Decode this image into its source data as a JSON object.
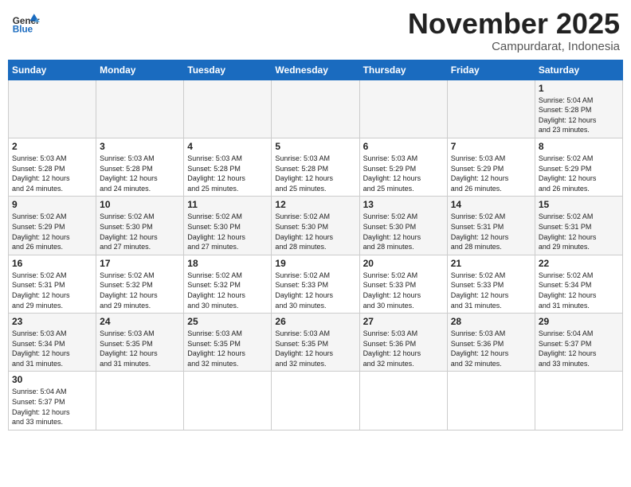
{
  "header": {
    "logo_general": "General",
    "logo_blue": "Blue",
    "month": "November 2025",
    "location": "Campurdarat, Indonesia"
  },
  "weekdays": [
    "Sunday",
    "Monday",
    "Tuesday",
    "Wednesday",
    "Thursday",
    "Friday",
    "Saturday"
  ],
  "weeks": [
    [
      {
        "day": "",
        "info": ""
      },
      {
        "day": "",
        "info": ""
      },
      {
        "day": "",
        "info": ""
      },
      {
        "day": "",
        "info": ""
      },
      {
        "day": "",
        "info": ""
      },
      {
        "day": "",
        "info": ""
      },
      {
        "day": "1",
        "info": "Sunrise: 5:04 AM\nSunset: 5:28 PM\nDaylight: 12 hours\nand 23 minutes."
      }
    ],
    [
      {
        "day": "2",
        "info": "Sunrise: 5:03 AM\nSunset: 5:28 PM\nDaylight: 12 hours\nand 24 minutes."
      },
      {
        "day": "3",
        "info": "Sunrise: 5:03 AM\nSunset: 5:28 PM\nDaylight: 12 hours\nand 24 minutes."
      },
      {
        "day": "4",
        "info": "Sunrise: 5:03 AM\nSunset: 5:28 PM\nDaylight: 12 hours\nand 25 minutes."
      },
      {
        "day": "5",
        "info": "Sunrise: 5:03 AM\nSunset: 5:28 PM\nDaylight: 12 hours\nand 25 minutes."
      },
      {
        "day": "6",
        "info": "Sunrise: 5:03 AM\nSunset: 5:29 PM\nDaylight: 12 hours\nand 25 minutes."
      },
      {
        "day": "7",
        "info": "Sunrise: 5:03 AM\nSunset: 5:29 PM\nDaylight: 12 hours\nand 26 minutes."
      },
      {
        "day": "8",
        "info": "Sunrise: 5:02 AM\nSunset: 5:29 PM\nDaylight: 12 hours\nand 26 minutes."
      }
    ],
    [
      {
        "day": "9",
        "info": "Sunrise: 5:02 AM\nSunset: 5:29 PM\nDaylight: 12 hours\nand 26 minutes."
      },
      {
        "day": "10",
        "info": "Sunrise: 5:02 AM\nSunset: 5:30 PM\nDaylight: 12 hours\nand 27 minutes."
      },
      {
        "day": "11",
        "info": "Sunrise: 5:02 AM\nSunset: 5:30 PM\nDaylight: 12 hours\nand 27 minutes."
      },
      {
        "day": "12",
        "info": "Sunrise: 5:02 AM\nSunset: 5:30 PM\nDaylight: 12 hours\nand 28 minutes."
      },
      {
        "day": "13",
        "info": "Sunrise: 5:02 AM\nSunset: 5:30 PM\nDaylight: 12 hours\nand 28 minutes."
      },
      {
        "day": "14",
        "info": "Sunrise: 5:02 AM\nSunset: 5:31 PM\nDaylight: 12 hours\nand 28 minutes."
      },
      {
        "day": "15",
        "info": "Sunrise: 5:02 AM\nSunset: 5:31 PM\nDaylight: 12 hours\nand 29 minutes."
      }
    ],
    [
      {
        "day": "16",
        "info": "Sunrise: 5:02 AM\nSunset: 5:31 PM\nDaylight: 12 hours\nand 29 minutes."
      },
      {
        "day": "17",
        "info": "Sunrise: 5:02 AM\nSunset: 5:32 PM\nDaylight: 12 hours\nand 29 minutes."
      },
      {
        "day": "18",
        "info": "Sunrise: 5:02 AM\nSunset: 5:32 PM\nDaylight: 12 hours\nand 30 minutes."
      },
      {
        "day": "19",
        "info": "Sunrise: 5:02 AM\nSunset: 5:33 PM\nDaylight: 12 hours\nand 30 minutes."
      },
      {
        "day": "20",
        "info": "Sunrise: 5:02 AM\nSunset: 5:33 PM\nDaylight: 12 hours\nand 30 minutes."
      },
      {
        "day": "21",
        "info": "Sunrise: 5:02 AM\nSunset: 5:33 PM\nDaylight: 12 hours\nand 31 minutes."
      },
      {
        "day": "22",
        "info": "Sunrise: 5:02 AM\nSunset: 5:34 PM\nDaylight: 12 hours\nand 31 minutes."
      }
    ],
    [
      {
        "day": "23",
        "info": "Sunrise: 5:03 AM\nSunset: 5:34 PM\nDaylight: 12 hours\nand 31 minutes."
      },
      {
        "day": "24",
        "info": "Sunrise: 5:03 AM\nSunset: 5:35 PM\nDaylight: 12 hours\nand 31 minutes."
      },
      {
        "day": "25",
        "info": "Sunrise: 5:03 AM\nSunset: 5:35 PM\nDaylight: 12 hours\nand 32 minutes."
      },
      {
        "day": "26",
        "info": "Sunrise: 5:03 AM\nSunset: 5:35 PM\nDaylight: 12 hours\nand 32 minutes."
      },
      {
        "day": "27",
        "info": "Sunrise: 5:03 AM\nSunset: 5:36 PM\nDaylight: 12 hours\nand 32 minutes."
      },
      {
        "day": "28",
        "info": "Sunrise: 5:03 AM\nSunset: 5:36 PM\nDaylight: 12 hours\nand 32 minutes."
      },
      {
        "day": "29",
        "info": "Sunrise: 5:04 AM\nSunset: 5:37 PM\nDaylight: 12 hours\nand 33 minutes."
      }
    ],
    [
      {
        "day": "30",
        "info": "Sunrise: 5:04 AM\nSunset: 5:37 PM\nDaylight: 12 hours\nand 33 minutes."
      },
      {
        "day": "",
        "info": ""
      },
      {
        "day": "",
        "info": ""
      },
      {
        "day": "",
        "info": ""
      },
      {
        "day": "",
        "info": ""
      },
      {
        "day": "",
        "info": ""
      },
      {
        "day": "",
        "info": ""
      }
    ]
  ]
}
